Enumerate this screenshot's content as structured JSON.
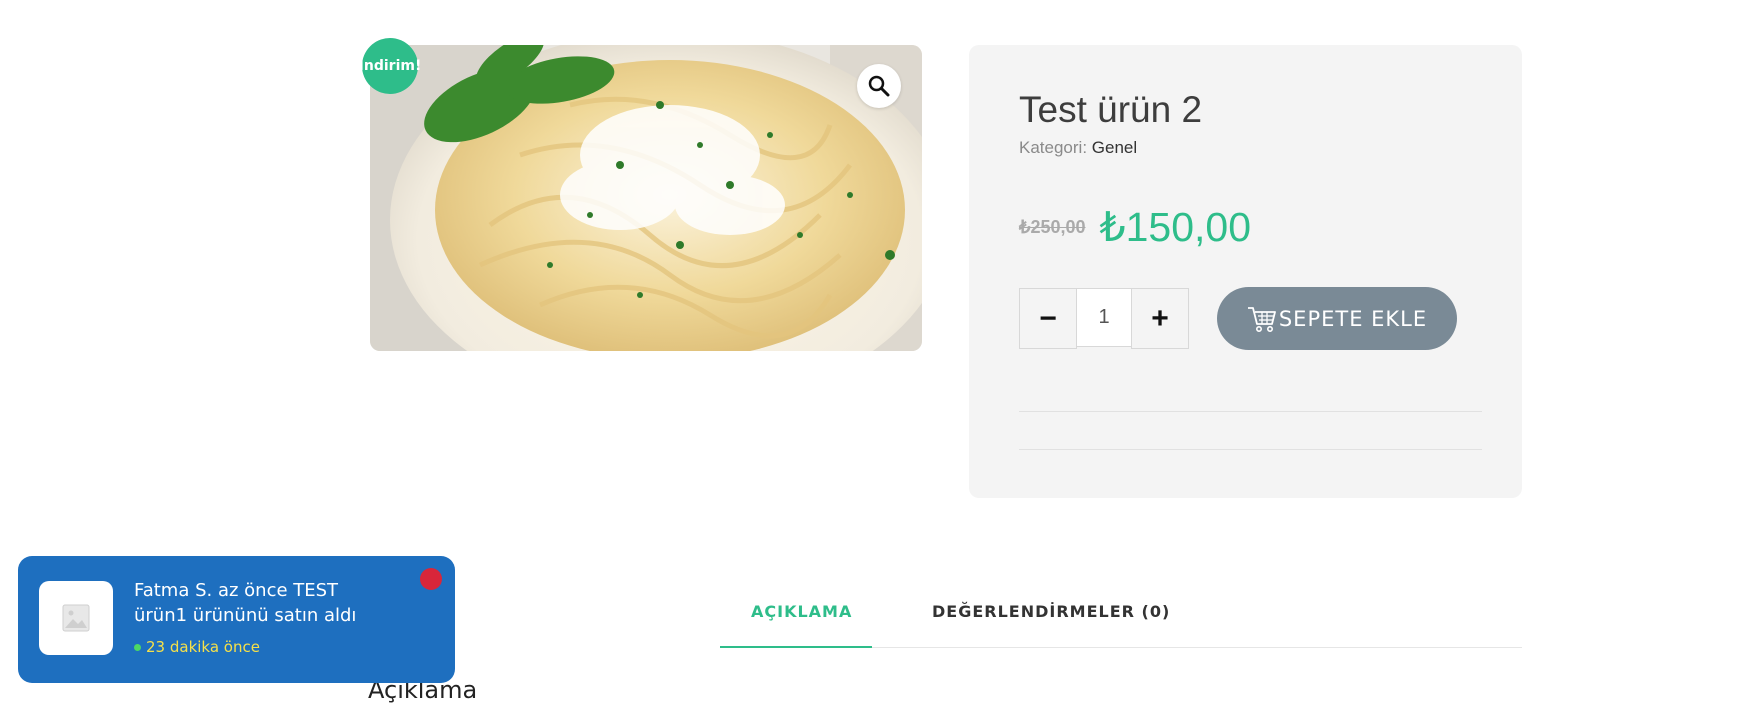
{
  "product": {
    "sale_badge": "İndirim!",
    "title": "Test ürün 2",
    "category_label": "Kategori:",
    "category_value": "Genel",
    "old_price": "₺250,00",
    "new_price": "₺150,00",
    "quantity": "1",
    "minus": "−",
    "plus": "+",
    "add_to_cart": "SEPETE EKLE"
  },
  "tabs": [
    {
      "label": "AÇIKLAMA",
      "active": true
    },
    {
      "label": "DEĞERLENDİRMELER (0)",
      "active": false
    }
  ],
  "section_heading": "Açıklama",
  "toast": {
    "message": "Fatma S. az önce TEST ürün1 ürününü satın aldı",
    "time": "23 dakika önce"
  },
  "colors": {
    "accent": "#2ebd8a",
    "toast_bg": "#1e6fbf",
    "cart_button": "#7a8a96",
    "close": "#d8263a"
  }
}
